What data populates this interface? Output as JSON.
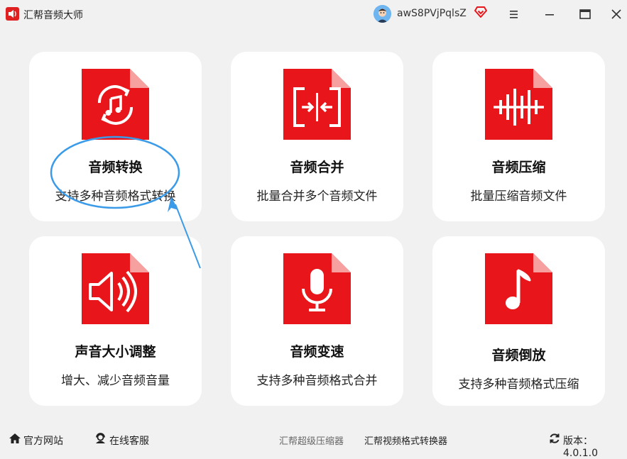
{
  "app": {
    "title": "汇帮音频大师",
    "username": "awS8PVjPqlsZ"
  },
  "cards": [
    {
      "title": "音频转换",
      "desc": "支持多种音频格式转换",
      "icon": "music-convert-icon"
    },
    {
      "title": "音频合并",
      "desc": "批量合并多个音频文件",
      "icon": "merge-icon"
    },
    {
      "title": "音频压缩",
      "desc": "批量压缩音频文件",
      "icon": "waveform-icon"
    },
    {
      "title": "声音大小调整",
      "desc": "增大、减少音频音量",
      "icon": "speaker-icon"
    },
    {
      "title": "音频变速",
      "desc": "支持多种音频格式合并",
      "icon": "microphone-icon"
    },
    {
      "title": "音频倒放",
      "desc": "支持多种音频格式压缩",
      "icon": "music-note-icon"
    }
  ],
  "footer": {
    "website": "官方网站",
    "support": "在线客服",
    "link1": "汇帮超级压缩器",
    "link2": "汇帮视频格式转换器",
    "version": "版本：4.0.1.0"
  },
  "colors": {
    "brand": "#e8151b",
    "annotation": "#3b9be8"
  }
}
